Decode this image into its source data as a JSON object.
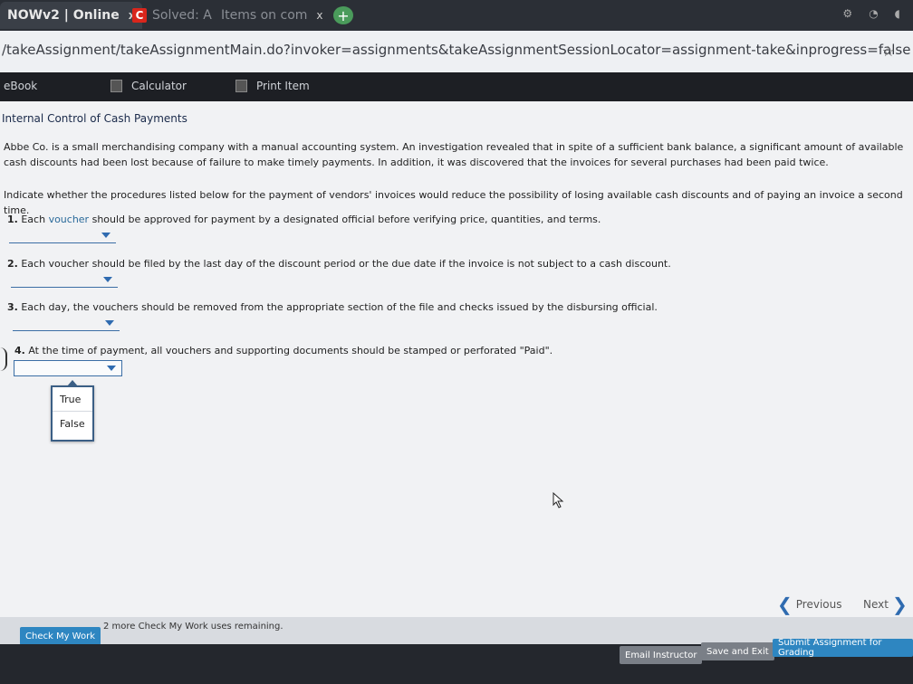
{
  "browser": {
    "tabs": [
      {
        "label": "NOWv2 | Online",
        "close": "x"
      },
      {
        "label": "Solved: A",
        "favicon": "C"
      },
      {
        "label": "Items on com",
        "close": "x"
      }
    ],
    "new_tab": "+",
    "url": "/takeAssignment/takeAssignmentMain.do?invoker=assignments&takeAssignmentSessionLocator=assignment-take&inprogress=false",
    "bookmark_icon": "star-icon"
  },
  "toolbar": {
    "ebook": "eBook",
    "calculator": "Calculator",
    "print": "Print Item"
  },
  "content": {
    "title": "Internal Control of Cash Payments",
    "intro": "Abbe Co. is a small merchandising company with a manual accounting system. An investigation revealed that in spite of a sufficient bank balance, a significant amount of available cash discounts had been lost because of failure to make timely payments. In addition, it was discovered that the invoices for several purchases had been paid twice.",
    "instruction": "Indicate whether the procedures listed below for the payment of vendors' invoices would reduce the possibility of losing available cash discounts and of paying an invoice a second time.",
    "questions": [
      {
        "num": "1.",
        "pre": "Each ",
        "highlight": "voucher",
        "post": " should be approved for payment by a designated official before verifying price, quantities, and terms."
      },
      {
        "num": "2.",
        "pre": "Each voucher should be filed by the last day of the discount period or the due date if the invoice is not subject to a cash discount.",
        "highlight": "",
        "post": ""
      },
      {
        "num": "3.",
        "pre": "Each day, the vouchers should be removed from the appropriate section of the file and checks issued by the disbursing official.",
        "highlight": "",
        "post": ""
      },
      {
        "num": "4.",
        "pre": "At the time of payment, all vouchers and supporting documents should be stamped or perforated \"Paid\".",
        "highlight": "",
        "post": ""
      }
    ],
    "dropdown_options": [
      "True",
      "False"
    ]
  },
  "nav": {
    "previous": "Previous",
    "next": "Next"
  },
  "footer": {
    "check_my_work": "Check My Work",
    "remaining": "2 more Check My Work uses remaining.",
    "email": "Email Instructor",
    "save_exit": "Save and Exit",
    "submit": "Submit Assignment for Grading"
  }
}
